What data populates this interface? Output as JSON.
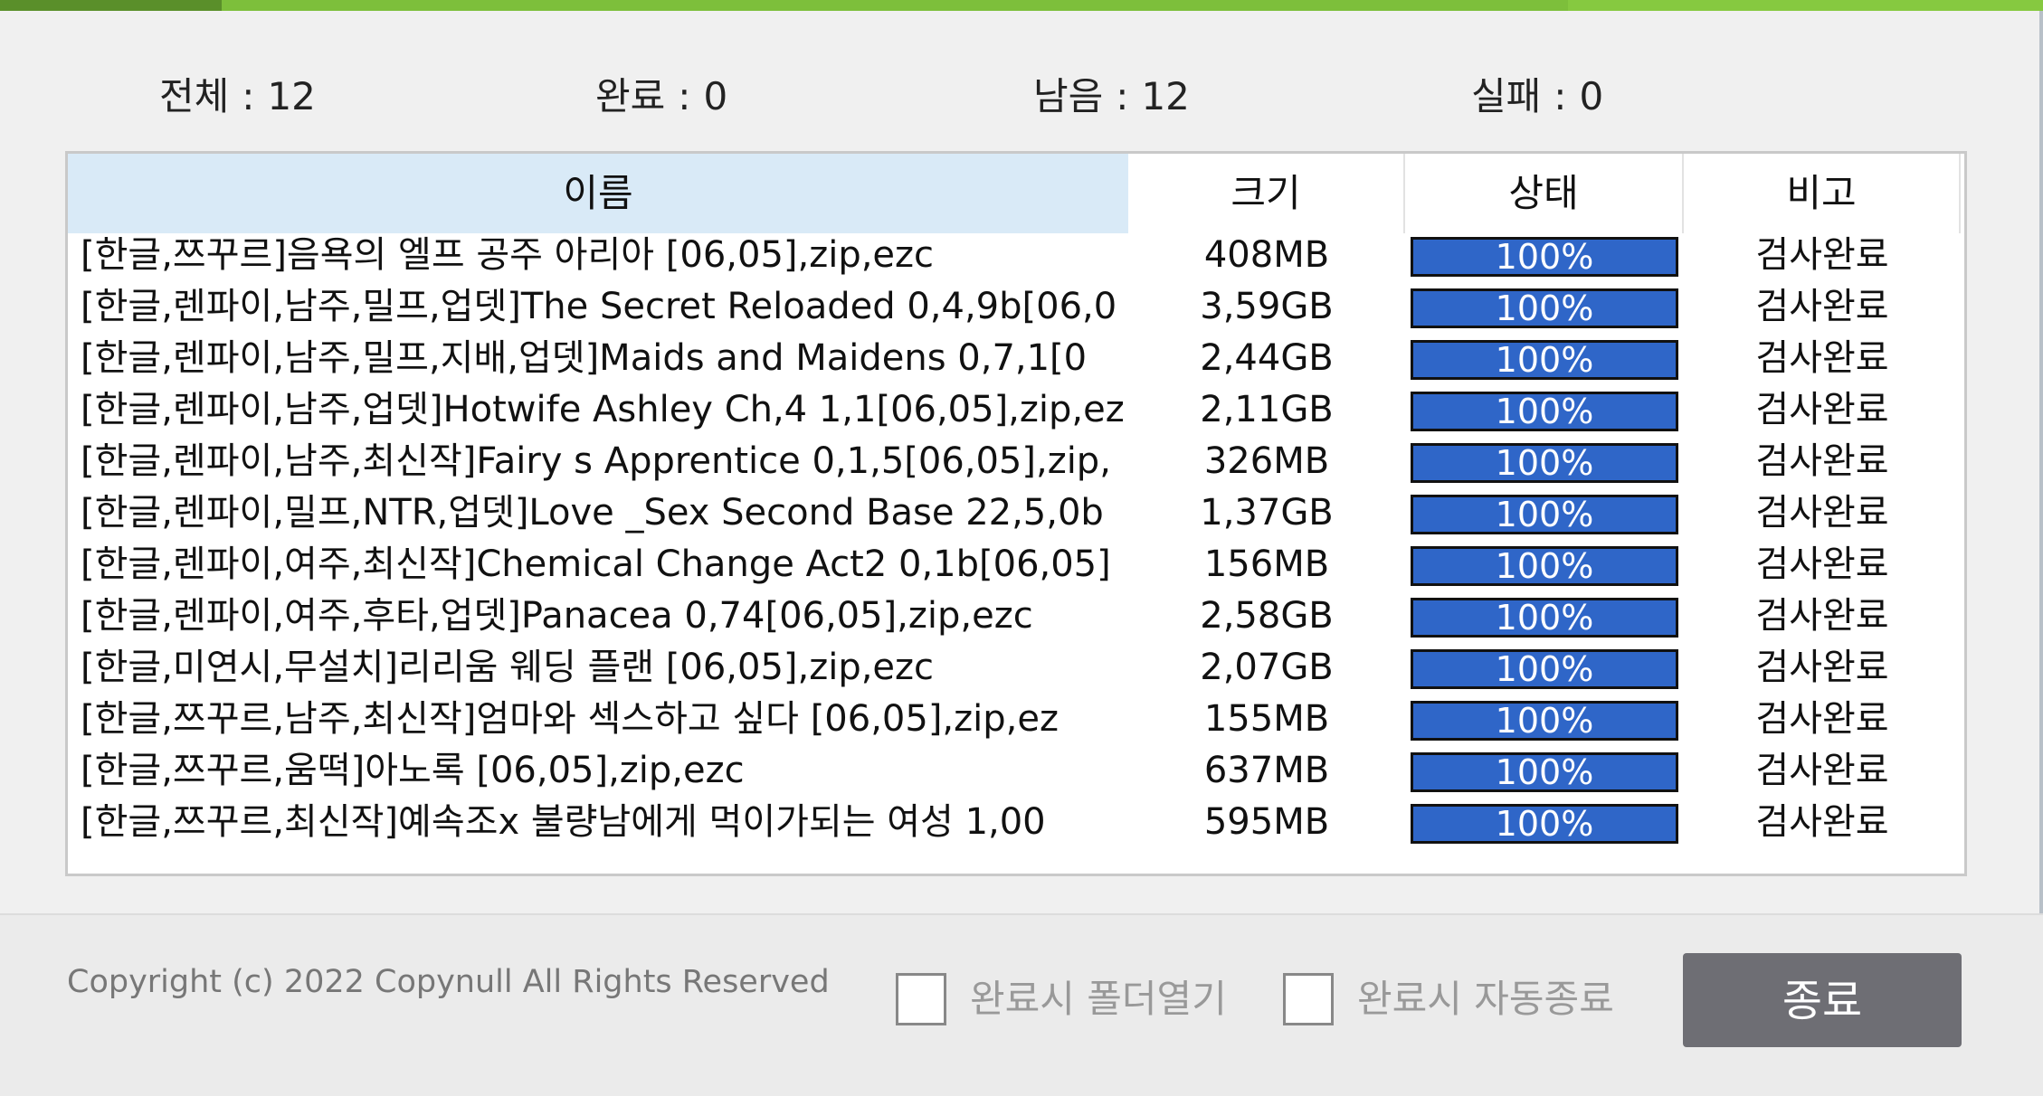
{
  "stats": {
    "total_label": "전체",
    "total_value": "12",
    "done_label": "완료",
    "done_value": "0",
    "remaining_label": "남음",
    "remaining_value": "12",
    "failed_label": "실패",
    "failed_value": "0"
  },
  "columns": {
    "name": "이름",
    "size": "크기",
    "status": "상태",
    "note": "비고"
  },
  "rows": [
    {
      "name": "[한글,쯔꾸르]음욕의 엘프 공주 아리아 [06,05],zip,ezc",
      "size": "408MB",
      "progress": "100%",
      "progress_value": 1.0,
      "note": "검사완료"
    },
    {
      "name": "[한글,렌파이,남주,밀프,업뎃]The Secret Reloaded 0,4,9b[06,0",
      "size": "3,59GB",
      "progress": "100%",
      "progress_value": 1.0,
      "note": "검사완료"
    },
    {
      "name": "[한글,렌파이,남주,밀프,지배,업뎃]Maids and Maidens 0,7,1[0",
      "size": "2,44GB",
      "progress": "100%",
      "progress_value": 1.0,
      "note": "검사완료"
    },
    {
      "name": "[한글,렌파이,남주,업뎃]Hotwife Ashley Ch,4 1,1[06,05],zip,ez",
      "size": "2,11GB",
      "progress": "100%",
      "progress_value": 1.0,
      "note": "검사완료"
    },
    {
      "name": "[한글,렌파이,남주,최신작]Fairy s Apprentice 0,1,5[06,05],zip,",
      "size": "326MB",
      "progress": "100%",
      "progress_value": 1.0,
      "note": "검사완료"
    },
    {
      "name": "[한글,렌파이,밀프,NTR,업뎃]Love _Sex Second Base 22,5,0b",
      "size": "1,37GB",
      "progress": "100%",
      "progress_value": 1.0,
      "note": "검사완료"
    },
    {
      "name": "[한글,렌파이,여주,최신작]Chemical Change Act2 0,1b[06,05]",
      "size": "156MB",
      "progress": "100%",
      "progress_value": 1.0,
      "note": "검사완료"
    },
    {
      "name": "[한글,렌파이,여주,후타,업뎃]Panacea 0,74[06,05],zip,ezc",
      "size": "2,58GB",
      "progress": "100%",
      "progress_value": 1.0,
      "note": "검사완료"
    },
    {
      "name": "[한글,미연시,무설치]리리움 웨딩 플랜 [06,05],zip,ezc",
      "size": "2,07GB",
      "progress": "100%",
      "progress_value": 1.0,
      "note": "검사완료"
    },
    {
      "name": "[한글,쯔꾸르,남주,최신작]엄마와 섹스하고 싶다 [06,05],zip,ez",
      "size": "155MB",
      "progress": "100%",
      "progress_value": 1.0,
      "note": "검사완료"
    },
    {
      "name": "[한글,쯔꾸르,움떡]아노록 [06,05],zip,ezc",
      "size": "637MB",
      "progress": "100%",
      "progress_value": 1.0,
      "note": "검사완료"
    },
    {
      "name": "[한글,쯔꾸르,최신작]예속조x 불량남에게 먹이가되는 여성 1,00",
      "size": "595MB",
      "progress": "100%",
      "progress_value": 1.0,
      "note": "검사완료"
    }
  ],
  "footer": {
    "copyright": "Copyright (c) 2022 Copynull All Rights Reserved",
    "open_folder_label": "완료시 폴더열기",
    "auto_close_label": "완료시 자동종료",
    "close_button_label": "종료"
  },
  "colors": {
    "accent_green": "#7dbf3b",
    "progress_blue": "#2f66c8",
    "button_gray": "#6e6e74",
    "header_highlight": "#d9eaf7"
  }
}
